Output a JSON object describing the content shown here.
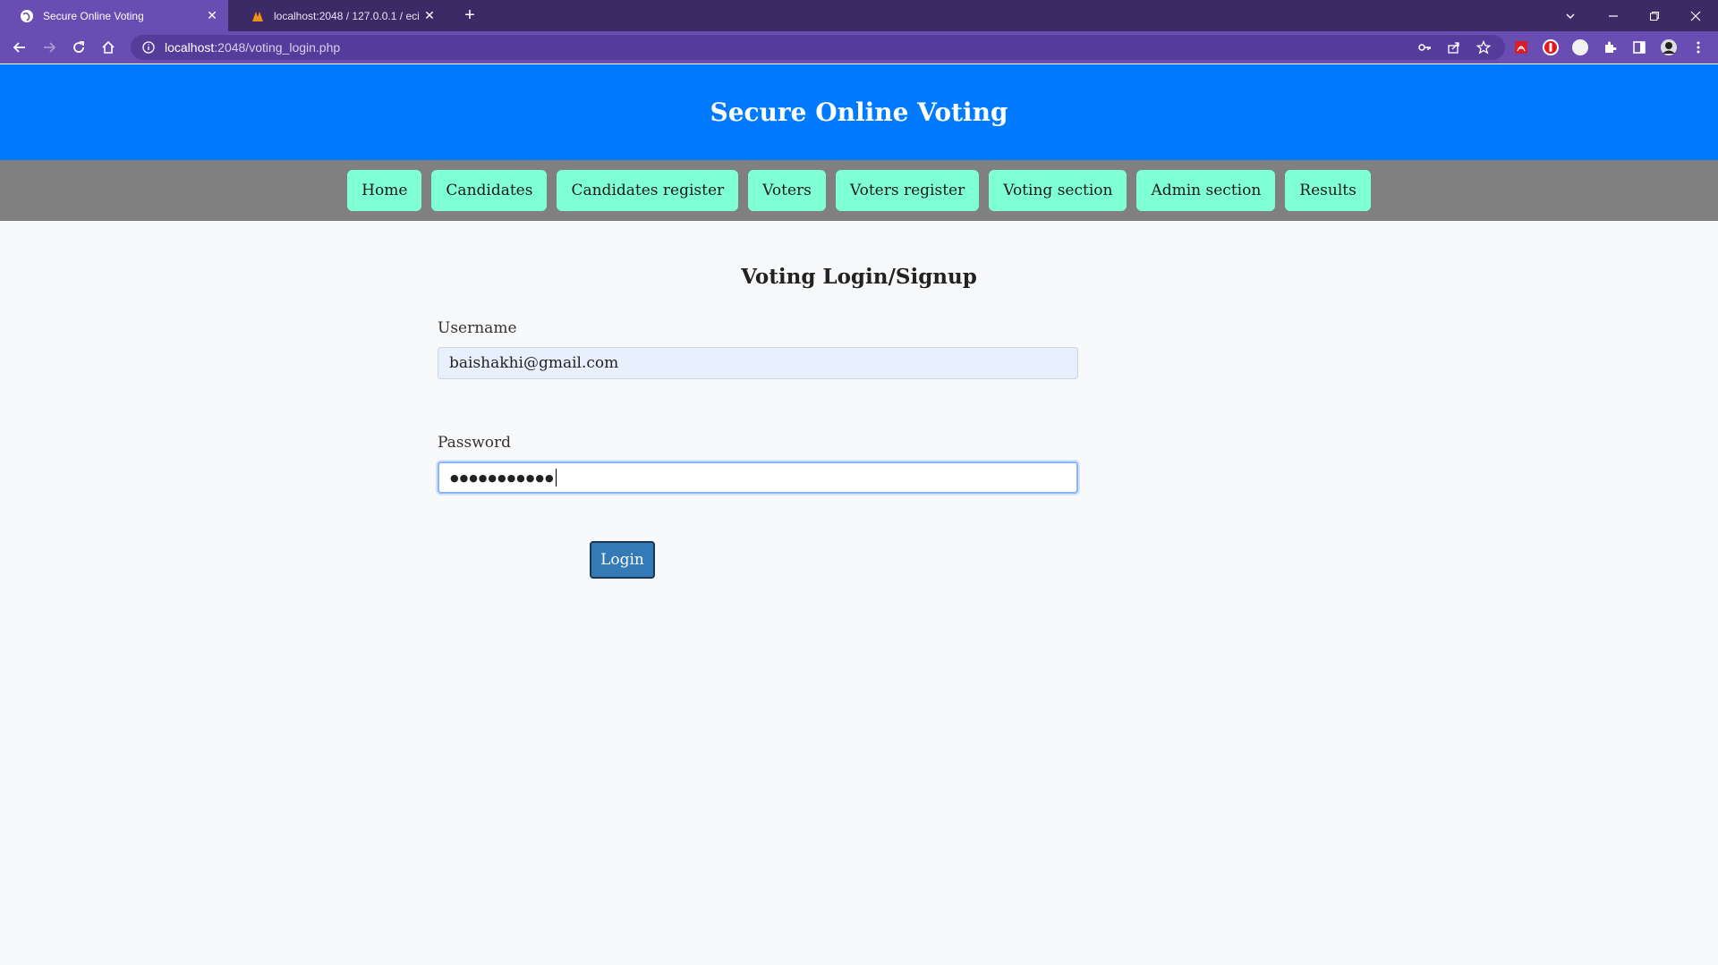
{
  "browser": {
    "tabs": [
      {
        "title": "Secure Online Voting",
        "active": true
      },
      {
        "title": "localhost:2048 / 127.0.0.1 / eci / ...",
        "active": false
      }
    ],
    "url_host": "localhost",
    "url_path": ":2048/voting_login.php"
  },
  "site": {
    "title": "Secure Online Voting"
  },
  "nav": {
    "items": [
      {
        "label": "Home"
      },
      {
        "label": "Candidates"
      },
      {
        "label": "Candidates register"
      },
      {
        "label": "Voters"
      },
      {
        "label": "Voters register"
      },
      {
        "label": "Voting section"
      },
      {
        "label": "Admin section"
      },
      {
        "label": "Results"
      }
    ]
  },
  "form": {
    "heading": "Voting Login/Signup",
    "username_label": "Username",
    "username_value": "baishakhi@gmail.com",
    "password_label": "Password",
    "password_masked": "●●●●●●●●●●●",
    "login_label": "Login"
  },
  "colors": {
    "header_bg": "#007bff",
    "nav_bg": "#808080",
    "nav_button_bg": "#7fffd4",
    "login_button_bg": "#337ab7",
    "tab_strip": "#3b2a66",
    "toolbar": "#6a4db3"
  }
}
